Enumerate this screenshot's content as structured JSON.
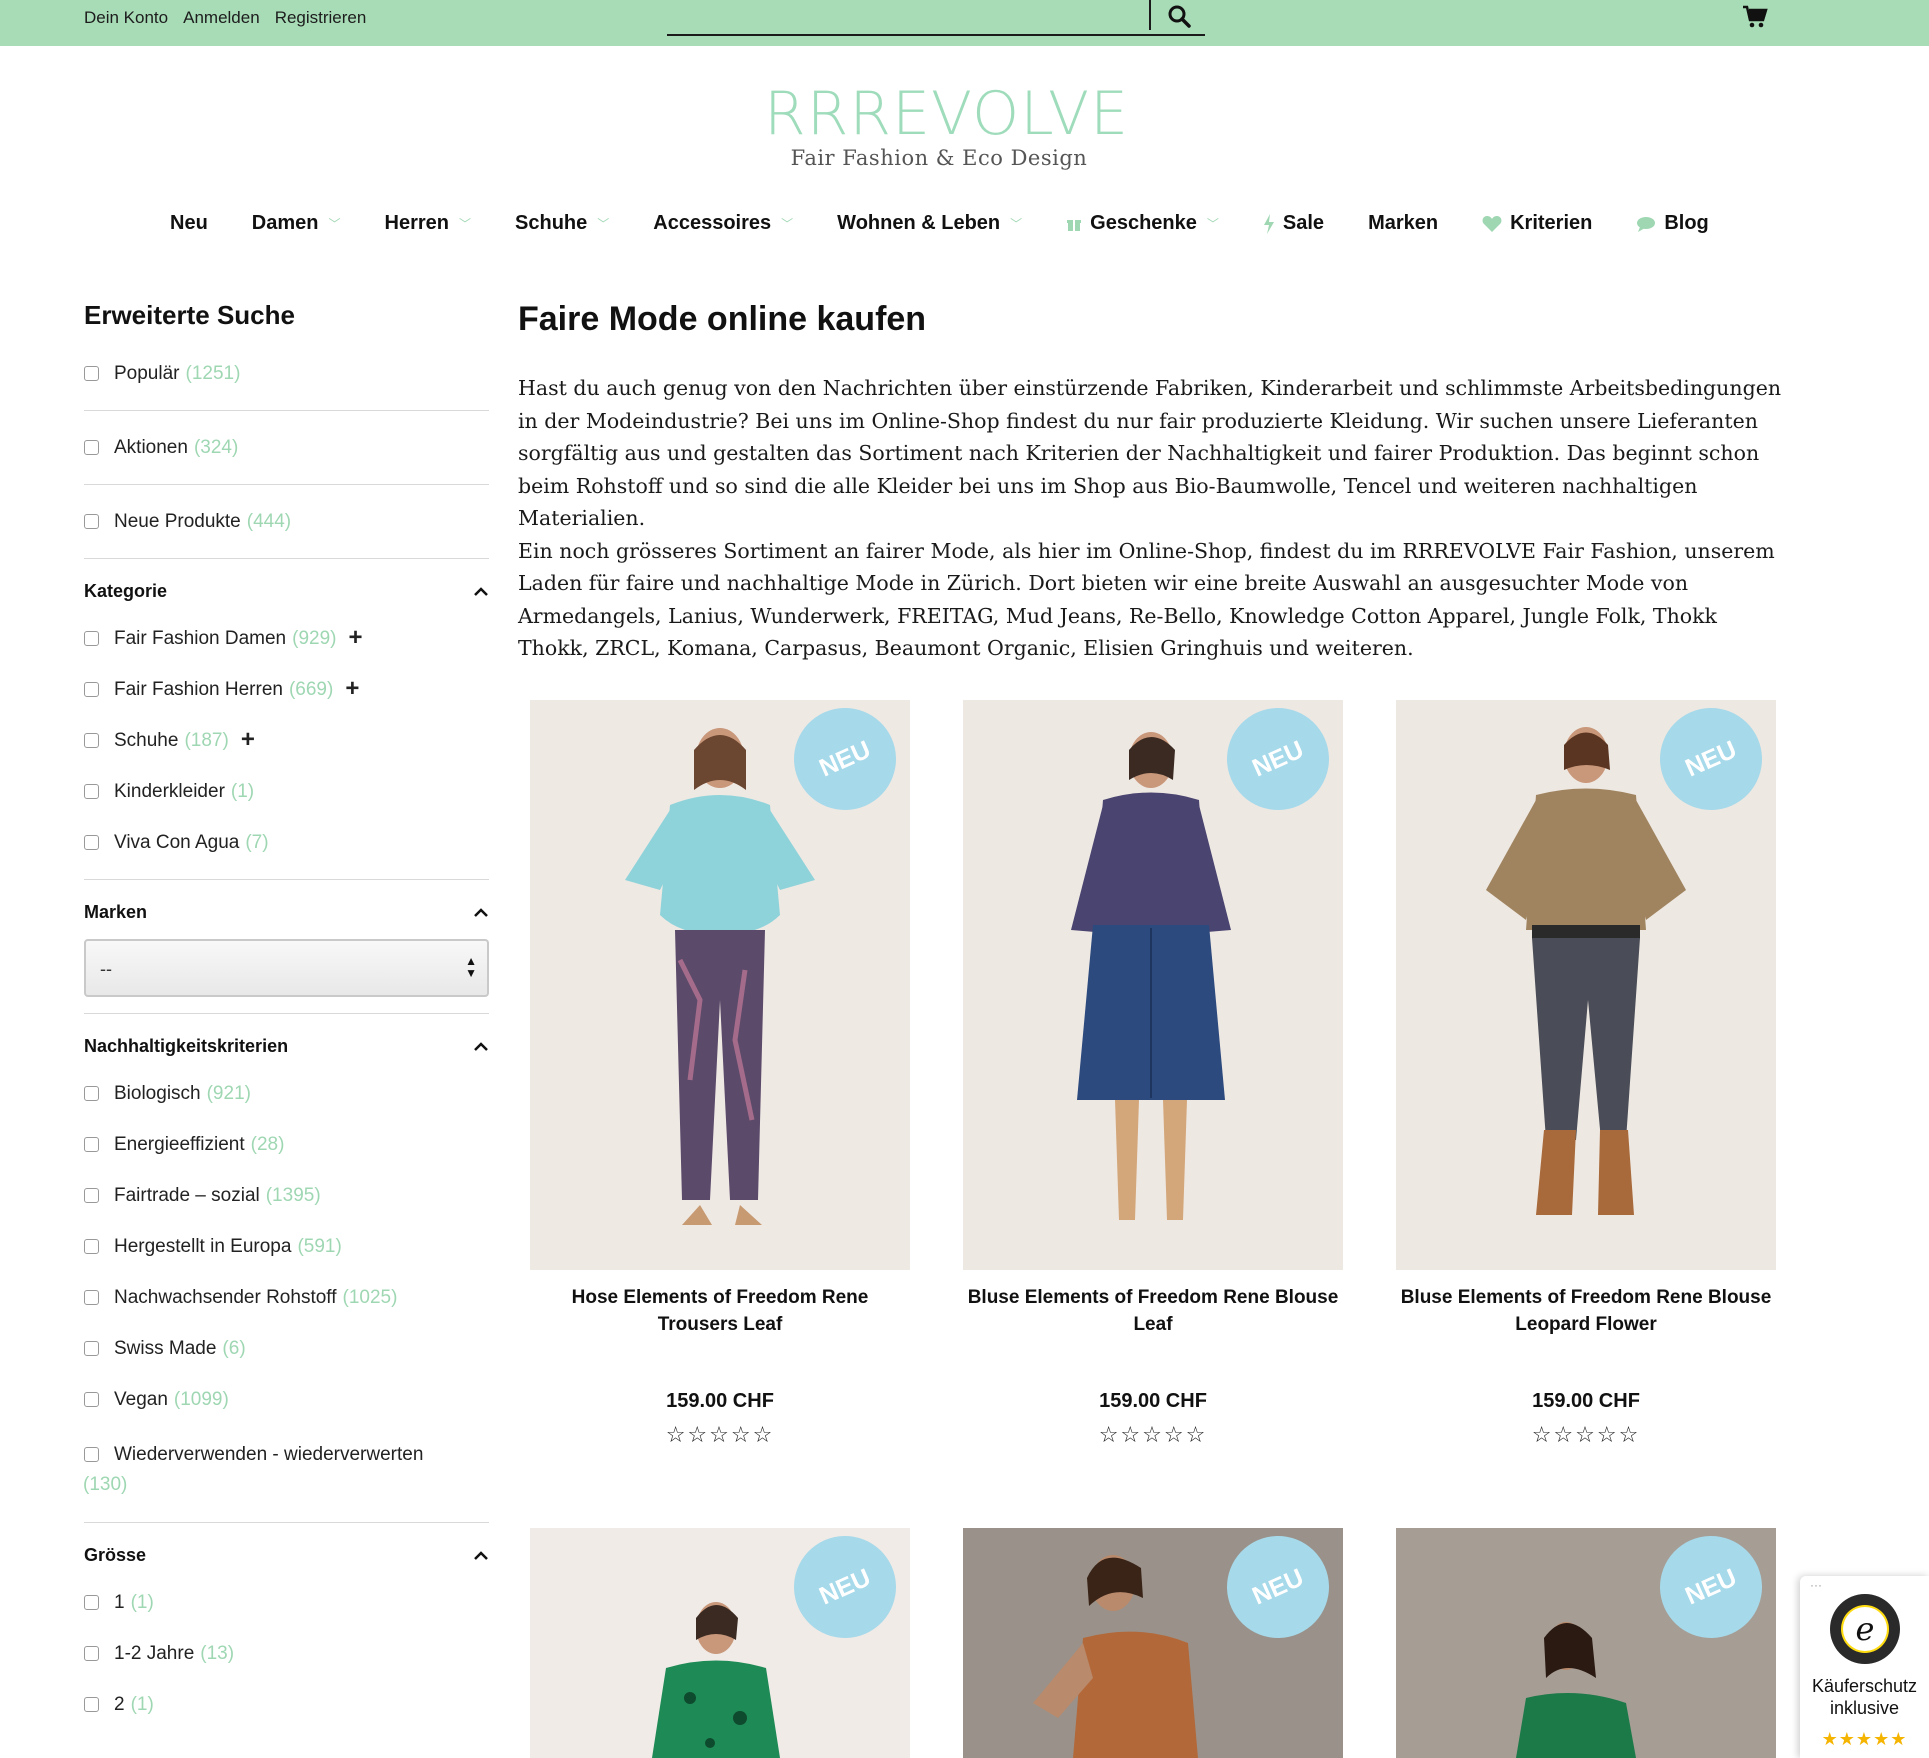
{
  "topbar": {
    "links": [
      "Dein Konto",
      "Anmelden",
      "Registrieren"
    ],
    "search_icon": "search-icon",
    "cart_icon": "cart-icon"
  },
  "logo": {
    "word": "RRREVOLVE",
    "subtitle": "Fair Fashion & Eco Design"
  },
  "nav": {
    "items": [
      {
        "label": "Neu",
        "dropdown": false,
        "icon": ""
      },
      {
        "label": "Damen",
        "dropdown": true,
        "icon": ""
      },
      {
        "label": "Herren",
        "dropdown": true,
        "icon": ""
      },
      {
        "label": "Schuhe",
        "dropdown": true,
        "icon": ""
      },
      {
        "label": "Accessoires",
        "dropdown": true,
        "icon": ""
      },
      {
        "label": "Wohnen & Leben",
        "dropdown": true,
        "icon": ""
      },
      {
        "label": "Geschenke",
        "dropdown": true,
        "icon": "gift-icon"
      },
      {
        "label": "Sale",
        "dropdown": false,
        "icon": "lightning-icon"
      },
      {
        "label": "Marken",
        "dropdown": false,
        "icon": ""
      },
      {
        "label": "Kriterien",
        "dropdown": false,
        "icon": "heart-icon"
      },
      {
        "label": "Blog",
        "dropdown": false,
        "icon": "speech-bubble-icon"
      }
    ]
  },
  "sidebar": {
    "title": "Erweiterte Suche",
    "quick_filters": [
      {
        "label": "Populär",
        "count": "(1251)"
      },
      {
        "label": "Aktionen",
        "count": "(324)"
      },
      {
        "label": "Neue Produkte",
        "count": "(444)"
      }
    ],
    "kategorie": {
      "title": "Kategorie",
      "items": [
        {
          "label": "Fair Fashion Damen",
          "count": "(929)",
          "expandable": true
        },
        {
          "label": "Fair Fashion Herren",
          "count": "(669)",
          "expandable": true
        },
        {
          "label": "Schuhe",
          "count": "(187)",
          "expandable": true
        },
        {
          "label": "Kinderkleider",
          "count": "(1)",
          "expandable": false
        },
        {
          "label": "Viva Con Agua",
          "count": "(7)",
          "expandable": false
        }
      ]
    },
    "marken": {
      "title": "Marken",
      "selected": "--"
    },
    "nachhaltigkeit": {
      "title": "Nachhaltigkeitskriterien",
      "items": [
        {
          "label": "Biologisch",
          "count": "(921)"
        },
        {
          "label": "Energieeffizient",
          "count": "(28)"
        },
        {
          "label": "Fairtrade – sozial",
          "count": "(1395)"
        },
        {
          "label": "Hergestellt in Europa",
          "count": "(591)"
        },
        {
          "label": "Nachwachsender Rohstoff",
          "count": "(1025)"
        },
        {
          "label": "Swiss Made",
          "count": "(6)"
        },
        {
          "label": "Vegan",
          "count": "(1099)"
        },
        {
          "label": "Wiederverwenden - wiederverwerten",
          "count": "(130)"
        }
      ]
    },
    "groesse": {
      "title": "Grösse",
      "items": [
        {
          "label": "1",
          "count": "(1)"
        },
        {
          "label": "1-2 Jahre",
          "count": "(13)"
        },
        {
          "label": "2",
          "count": "(1)"
        }
      ]
    }
  },
  "main": {
    "title": "Faire Mode online kaufen",
    "intro_p1": "Hast du auch genug von den Nachrichten über einstürzende Fabriken, Kinderarbeit und schlimmste Arbeitsbedingungen in der Modeindustrie? Bei uns im Online-Shop findest du nur fair produzierte Kleidung. Wir suchen unsere Lieferanten sorgfältig aus und gestalten das Sortiment nach Kriterien der Nachhaltigkeit und fairer Produktion. Das beginnt schon beim Rohstoff und so sind die alle Kleider bei uns im Shop aus Bio-Baumwolle, Tencel und weiteren nachhaltigen Materialien.",
    "intro_p2": "Ein noch grösseres Sortiment an fairer Mode, als hier im Online-Shop, findest du im RRREVOLVE Fair Fashion, unserem Laden für faire und nachhaltige Mode in Zürich. Dort bieten wir eine breite Auswahl an ausgesuchter Mode von Armedangels, Lanius, Wunderwerk, FREITAG, Mud Jeans, Re-Bello, Knowledge Cotton Apparel, Jungle Folk, Thokk Thokk, ZRCL, Komana, Carpasus, Beaumont Organic, Elisien Gringhuis und weiteren.",
    "products": [
      {
        "name": "Hose Elements of Freedom Rene Trousers Leaf",
        "price": "159.00 CHF",
        "badge": "NEU",
        "rating": 0
      },
      {
        "name": "Bluse Elements of Freedom Rene Blouse Leaf",
        "price": "159.00 CHF",
        "badge": "NEU",
        "rating": 0
      },
      {
        "name": "Bluse Elements of Freedom Rene Blouse Leopard Flower",
        "price": "159.00 CHF",
        "badge": "NEU",
        "rating": 0
      },
      {
        "name": "",
        "price": "",
        "badge": "NEU",
        "rating": 0
      },
      {
        "name": "",
        "price": "",
        "badge": "NEU",
        "rating": 0
      },
      {
        "name": "",
        "price": "",
        "badge": "NEU",
        "rating": 0
      }
    ]
  },
  "trusted": {
    "line1": "Käuferschutz",
    "line2": "inklusive",
    "stars": "★★★★★",
    "dots": "···"
  },
  "colors": {
    "topbar": "#a8dcb6",
    "accent": "#9fd7b3",
    "badge": "#a6d9ea"
  }
}
